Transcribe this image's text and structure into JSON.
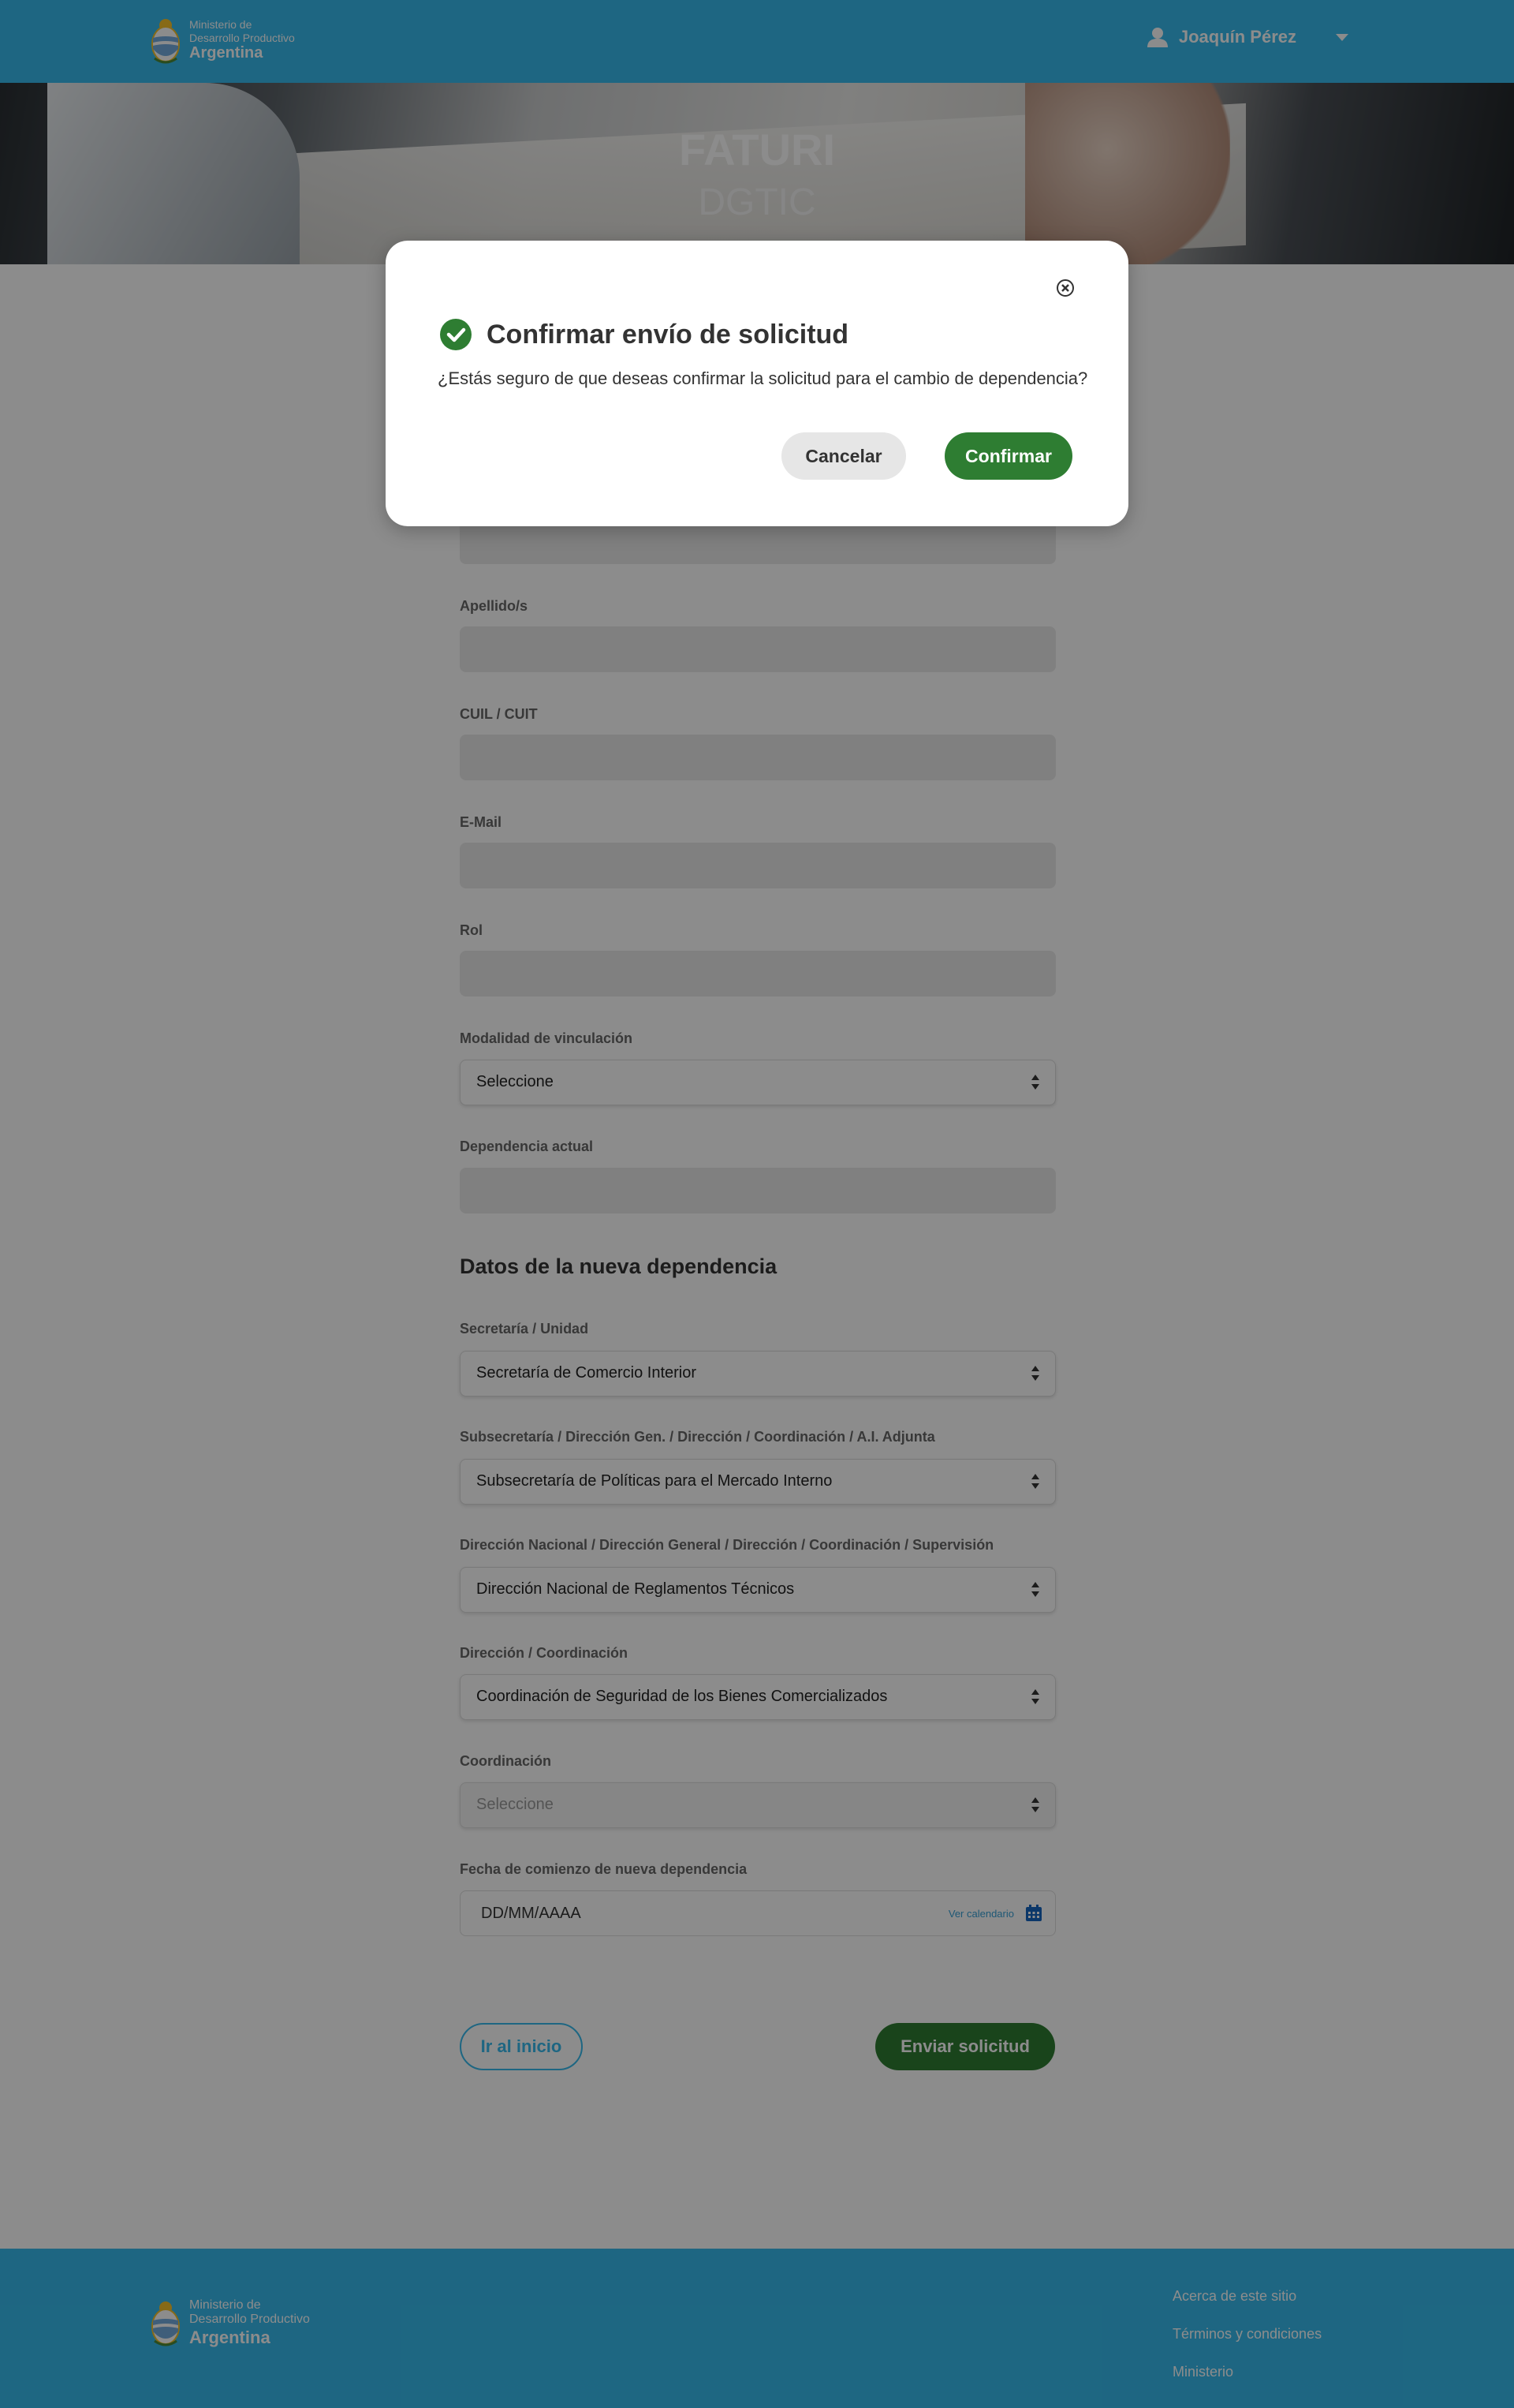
{
  "header": {
    "ministry_line1": "Ministerio de",
    "ministry_line2": "Desarrollo Productivo",
    "country": "Argentina",
    "user_name": "Joaquín Pérez",
    "icons": [
      "argentina-coat-of-arms-icon",
      "user-icon",
      "caret-down-icon"
    ]
  },
  "hero": {
    "title": "FATURI",
    "subtitle": "DGTIC"
  },
  "form": {
    "fields": {
      "apellidos": {
        "label": "Apellido/s",
        "value": ""
      },
      "cuil": {
        "label": "CUIL / CUIT",
        "value": ""
      },
      "email": {
        "label": "E-Mail",
        "value": ""
      },
      "rol": {
        "label": "Rol",
        "value": ""
      },
      "modalidad": {
        "label": "Modalidad de vinculación",
        "value": "Seleccione"
      },
      "dependencia_actual": {
        "label": "Dependencia actual",
        "value": ""
      }
    },
    "section_title": "Datos de la nueva dependencia",
    "new": {
      "secretaria": {
        "label": "Secretaría / Unidad",
        "value": "Secretaría de Comercio Interior"
      },
      "subsecretaria": {
        "label": "Subsecretaría / Dirección Gen. / Dirección / Coordinación / A.I. Adjunta",
        "value": "Subsecretaría de Políticas para el Mercado Interno"
      },
      "direccion_nacional": {
        "label": "Dirección Nacional / Dirección General / Dirección / Coordinación / Supervisión",
        "value": "Dirección Nacional de Reglamentos Técnicos"
      },
      "direccion": {
        "label": "Dirección / Coordinación",
        "value": "Coordinación de Seguridad de los Bienes Comercializados"
      },
      "coordinacion": {
        "label": "Coordinación",
        "value": "Seleccione"
      },
      "fecha": {
        "label": "Fecha de comienzo de nueva dependencia",
        "placeholder": "DD/MM/AAAA",
        "calendar_link": "Ver calendario"
      }
    },
    "buttons": {
      "home": "Ir al inicio",
      "submit": "Enviar solicitud"
    }
  },
  "modal": {
    "title": "Confirmar envío de solicitud",
    "message": "¿Estás seguro de que deseas confirmar la solicitud para el cambio de dependencia?",
    "cancel": "Cancelar",
    "confirm": "Confirmar",
    "icons": [
      "check-circle-icon",
      "close-icon"
    ]
  },
  "footer": {
    "ministry_line1": "Ministerio de",
    "ministry_line2": "Desarrollo Productivo",
    "country": "Argentina",
    "links": [
      "Acerca de este sitio",
      "Términos y condiciones",
      "Ministerio"
    ]
  },
  "colors": {
    "brand_blue": "#37bbed",
    "confirm_green": "#2e7d32",
    "overlay": "rgba(0,0,0,0.45)"
  }
}
